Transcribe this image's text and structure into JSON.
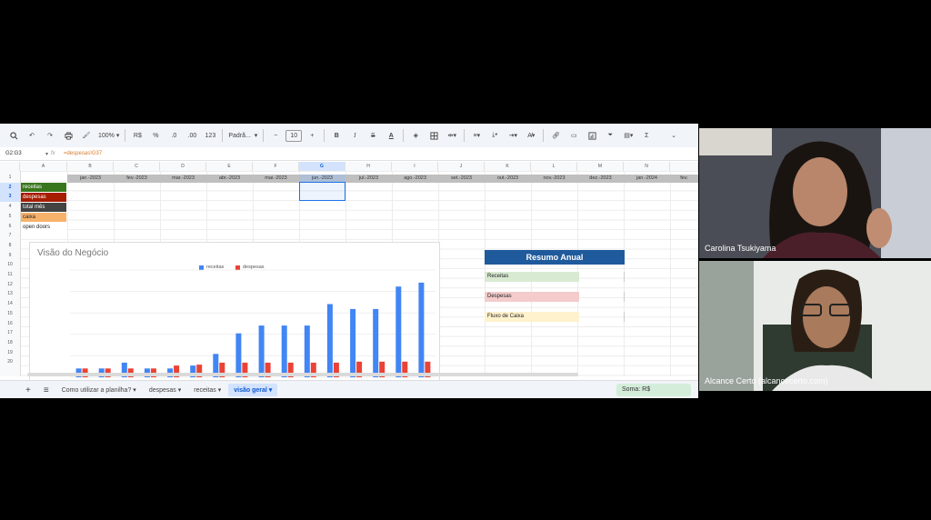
{
  "toolbar": {
    "zoom": "100%",
    "currency": "R$",
    "percent": "%",
    "decimals_dec": ".0",
    "decimals_inc": ".00",
    "number_format": "123",
    "font": "Padrã...",
    "font_size": "10",
    "bold": "B",
    "italic": "I",
    "strike": "S",
    "text_color": "A",
    "sigma": "Σ"
  },
  "formula_bar": {
    "name_box": "G2:G3",
    "fx": "fx",
    "formula": "=despesas!G37"
  },
  "columns": [
    "A",
    "B",
    "C",
    "D",
    "E",
    "F",
    "G",
    "H",
    "I",
    "J",
    "K",
    "L",
    "M",
    "N"
  ],
  "rows": [
    "1",
    "2",
    "3",
    "4",
    "5",
    "6",
    "7",
    "8",
    "9",
    "10",
    "11",
    "12",
    "13",
    "14",
    "15",
    "16",
    "17",
    "18",
    "19",
    "20"
  ],
  "row_labels": [
    {
      "label": "receitas",
      "bg": "#38761d",
      "fg": "#ffffff"
    },
    {
      "label": "despesas",
      "bg": "#a61c00",
      "fg": "#ffffff"
    },
    {
      "label": "total mês",
      "bg": "#434343",
      "fg": "#ffffff"
    },
    {
      "label": "caixa",
      "bg": "#f6b26b",
      "fg": "#222222"
    },
    {
      "label": "open doors",
      "bg": "#ffffff",
      "fg": "#222222"
    }
  ],
  "months": [
    "jan.-2023",
    "fev.-2023",
    "mar.-2023",
    "abr.-2023",
    "mai.-2023",
    "jun.-2023",
    "jul.-2023",
    "ago.-2023",
    "set.-2023",
    "out.-2023",
    "nov.-2023",
    "dez.-2023",
    "jan.-2024",
    "fev."
  ],
  "chart": {
    "title": "Visão do Negócio",
    "legend": [
      "receitas",
      "despesas"
    ]
  },
  "chart_data": {
    "type": "bar",
    "title": "Visão do Negócio",
    "categories": [
      "1",
      "2",
      "3",
      "4",
      "5",
      "6",
      "7",
      "8",
      "9",
      "10",
      "11",
      "12",
      "13",
      "14",
      "15",
      "16"
    ],
    "series": [
      {
        "name": "receitas",
        "color": "#4285f4",
        "values": [
          9,
          9,
          15,
          9,
          9,
          12,
          24,
          45,
          53,
          53,
          53,
          75,
          70,
          70,
          93,
          97
        ]
      },
      {
        "name": "despesas",
        "color": "#ea4335",
        "values": [
          9,
          9,
          9,
          9,
          12,
          13,
          15,
          15,
          15,
          15,
          15,
          15,
          16,
          16,
          16,
          16
        ]
      }
    ],
    "ylim": [
      0,
      110
    ]
  },
  "resumo": {
    "title": "Resumo Anual",
    "rows": [
      {
        "label": "Receitas",
        "bg": "#d9ead3"
      },
      {
        "label": "Despesas",
        "bg": "#f4cccc"
      },
      {
        "label": "Fluxo de Caixa",
        "bg": "#fff2cc"
      }
    ]
  },
  "tabs": {
    "add": "+",
    "menu": "≡",
    "items": [
      "Como utilizar a planilha?",
      "despesas",
      "receitas",
      "visão geral"
    ],
    "active_index": 3
  },
  "status": {
    "soma": "Soma: R$"
  },
  "participants": [
    {
      "name": "Carolina Tsukiyama"
    },
    {
      "name": "Alcance Certo (alcancecerto.com)"
    }
  ]
}
